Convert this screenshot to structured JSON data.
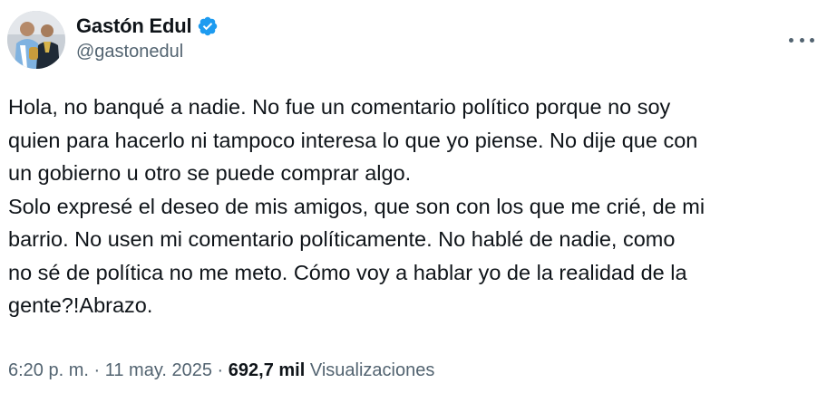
{
  "author": {
    "display_name": "Gastón Edul",
    "handle": "@gastonedul",
    "verified": true,
    "avatar": "profile-photo"
  },
  "menu": {
    "icon": "more-horizontal-icon"
  },
  "tweet": {
    "lines": [
      "Hola, no banqué a nadie. No fue un comentario político porque no soy",
      "quien para hacerlo ni tampoco interesa lo que yo piense. No dije que con",
      "un gobierno u otro se puede comprar algo.",
      "Solo expresé el deseo de mis amigos, que son con los que me crié, de mi",
      "barrio. No usen mi comentario políticamente. No hablé de nadie, como",
      "no sé de política no me meto. Cómo voy a hablar yo de la realidad de la",
      "gente?!Abrazo."
    ]
  },
  "meta": {
    "time": "6:20 p. m.",
    "separator": "·",
    "date": "11 may. 2025",
    "views_count": "692,7 mil",
    "views_label": "Visualizaciones"
  },
  "colors": {
    "text": "#0f1419",
    "secondary": "#536471",
    "verified": "#1d9bf0"
  }
}
